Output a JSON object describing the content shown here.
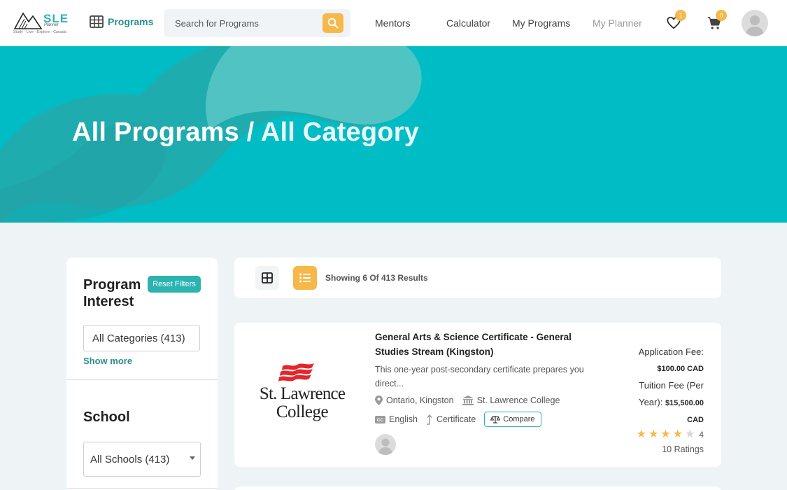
{
  "brand": {
    "logo_text": "SLE",
    "logo_subtext": "Planner",
    "tagline": "Study · Live · Explore · Canada"
  },
  "nav": {
    "programs_label": "Programs",
    "search_placeholder": "Search for Programs",
    "links": [
      "Mentors",
      "Calculator",
      "My Programs",
      "My Planner"
    ],
    "wishlist_count": "1",
    "cart_count": "0"
  },
  "hero": {
    "title_part1": "All Programs /",
    "title_part2": "All Category"
  },
  "sidebar": {
    "program_interest_title": "Program Interest",
    "reset_label": "Reset Filters",
    "category_value": "All Categories (413)",
    "show_more": "Show more",
    "school_title": "School",
    "school_value": "All Schools (413)"
  },
  "results": {
    "showing_text": "Showing 6 Of 413 Results"
  },
  "program": {
    "title": "General Arts & Science Certificate - General Studies Stream (Kingston)",
    "description": "This one-year post-secondary certificate prepares you direct...",
    "location": "Ontario, Kingston",
    "school": "St. Lawrence College",
    "language": "English",
    "credential": "Certificate",
    "compare_label": "Compare",
    "college_logo_line1": "St. Lawrence",
    "college_logo_line2": "College",
    "application_fee_label": "Application Fee:",
    "application_fee": "$100.00 CAD",
    "tuition_label_1": "Tuition Fee (Per",
    "tuition_label_2": "Year):",
    "tuition_fee": "$15,500.00",
    "tuition_currency": "CAD",
    "rating": "4",
    "rating_value": 4,
    "rating_max": 5,
    "ratings_count": "10 Ratings"
  },
  "colors": {
    "teal": "#2bb3b1",
    "hero": "#00bcc4",
    "accent": "#f7b84a",
    "college_red": "#e3262b"
  }
}
